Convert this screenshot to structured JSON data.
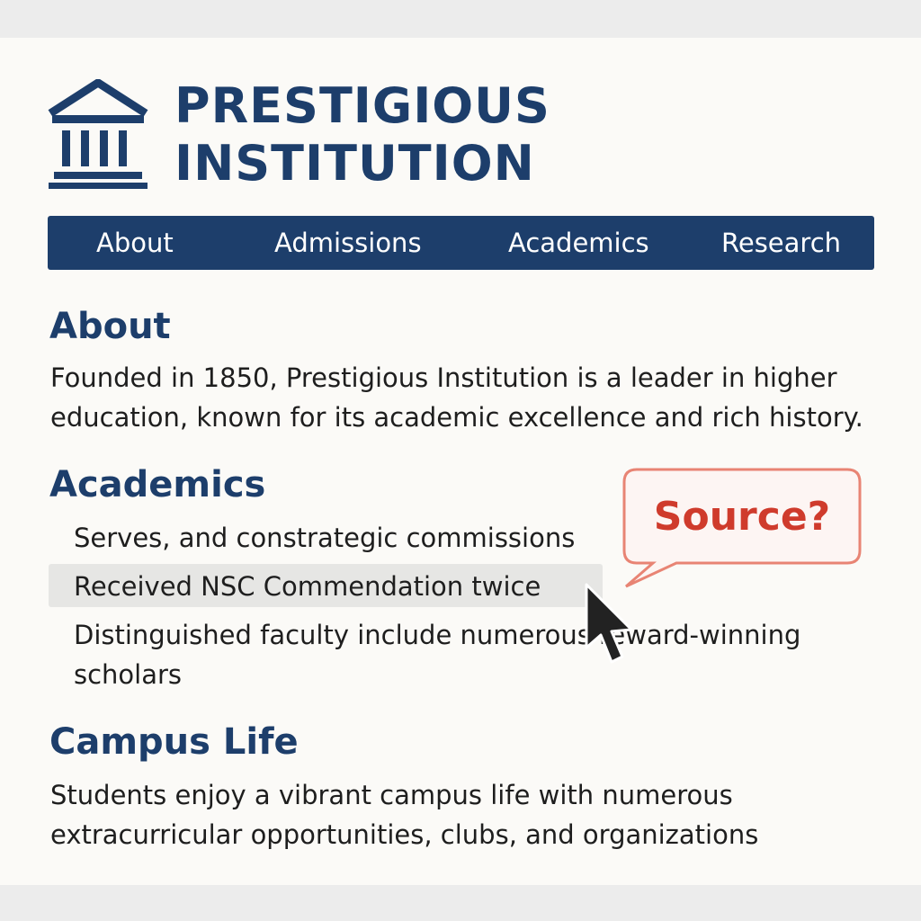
{
  "site": {
    "title_line1": "PRESTIGIOUS",
    "title_line2": "INSTITUTION",
    "logo_icon": "institution-columns-icon"
  },
  "nav": {
    "items": [
      {
        "label": "About"
      },
      {
        "label": "Admissions"
      },
      {
        "label": "Academics"
      },
      {
        "label": "Research"
      }
    ]
  },
  "sections": {
    "about": {
      "heading": "About",
      "text_line1": "Founded in 1850, Prestigious Institution is a leader in higher",
      "text_line2": "education, known for its academic excellence and rich history."
    },
    "academics": {
      "heading": "Academics",
      "items": [
        {
          "text": "Serves, and constrategic commissions"
        },
        {
          "text": "Received NSC Commendation twice"
        },
        {
          "text_line1": "Distinguished faculty include numerous reward-winning",
          "text_line2": "scholars"
        }
      ]
    },
    "campus_life": {
      "heading": "Campus Life",
      "text_line1": "Students enjoy a vibrant campus life with numerous",
      "text_line2": "extracurricular opportunities, clubs, and organizations"
    }
  },
  "annotation": {
    "bubble_text": "Source?",
    "bubble_color": "#cf3b2c"
  },
  "colors": {
    "brand": "#1d3e6b",
    "page_background": "#fbfaf7",
    "highlight": "#e6e6e4"
  }
}
